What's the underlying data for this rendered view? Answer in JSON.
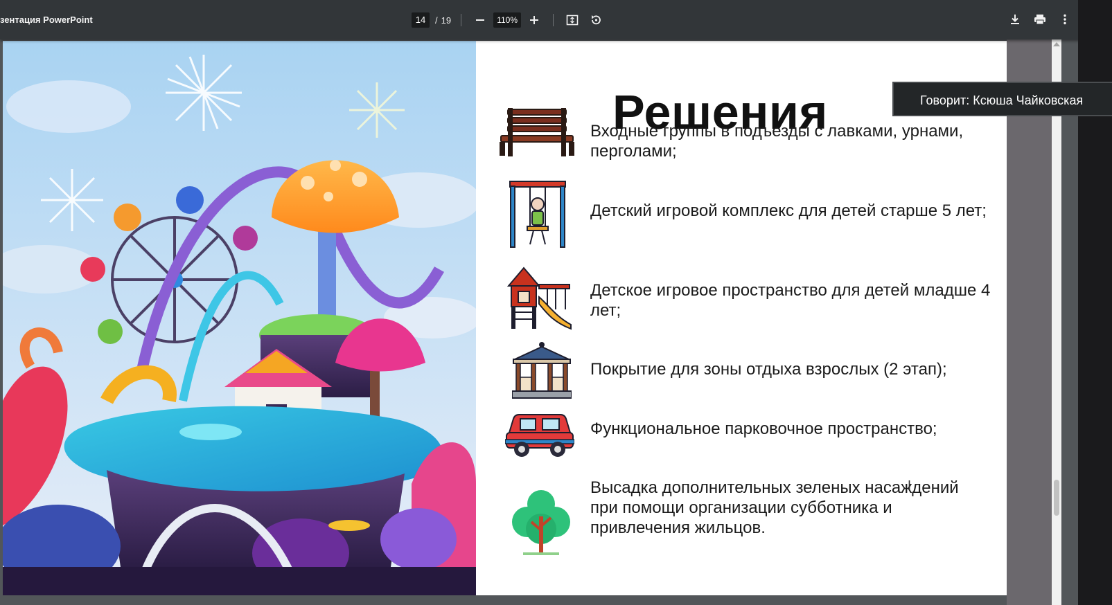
{
  "toolbar": {
    "doc_title": "зентация PowerPoint",
    "current_page": "14",
    "page_separator": "/",
    "total_pages": "19",
    "zoom": "110%"
  },
  "slide": {
    "title": "Решения",
    "items": [
      {
        "text": "Входные группы в подъезды с лавками, урнами, перголами;",
        "icon": "bench-icon"
      },
      {
        "text": "Детский игровой комплекс  для детей старше 5 лет;",
        "icon": "swing-icon"
      },
      {
        "text": "Детское игровое пространство для детей младше 4 лет;",
        "icon": "playhouse-slide-icon"
      },
      {
        "text": "Покрытие для зоны отдыха взрослых (2 этап);",
        "icon": "gazebo-icon"
      },
      {
        "text": "Функциональное парковочное пространство;",
        "icon": "car-icon"
      },
      {
        "text": "Высадка дополнительных зеленых насаждений при помощи организации субботника и привлечения жильцов.",
        "icon": "tree-icon"
      }
    ]
  },
  "speaker": {
    "label": "Говорит: Ксюша Чайковская"
  },
  "colors": {
    "toolbar_bg": "#323639",
    "viewer_bg": "#525659",
    "text": "#1b1b1b"
  }
}
